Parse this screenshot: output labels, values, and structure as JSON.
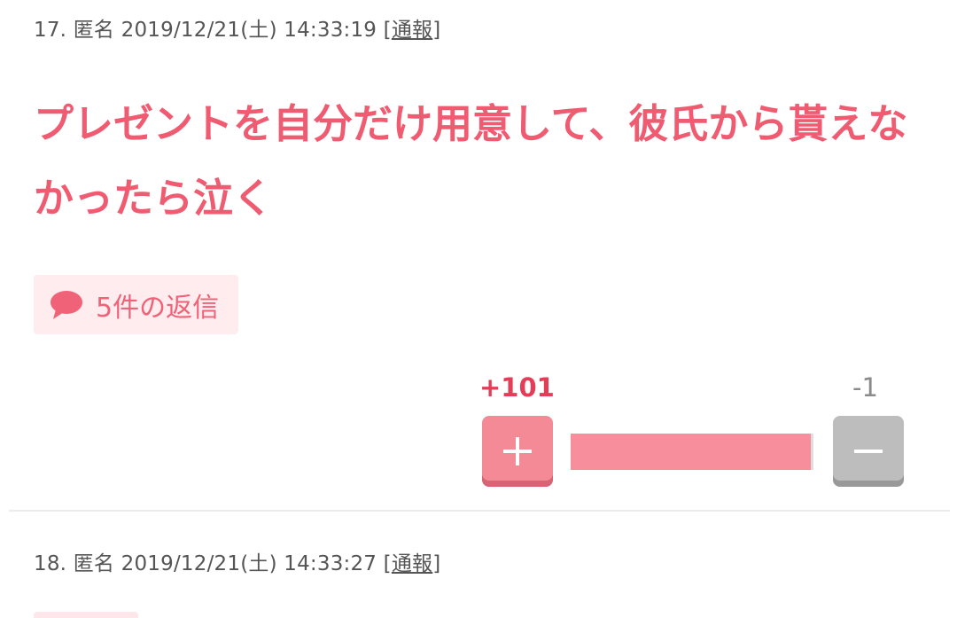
{
  "comments": [
    {
      "number": "17.",
      "author": "匿名",
      "datetime": "2019/12/21(土) 14:33:19",
      "report_label": "通報",
      "text": "プレゼントを自分だけ用意して、彼氏から貰えなかったら泣く",
      "replies_label": "5件の返信",
      "plus_count": "+101",
      "minus_count": "-1",
      "vote_ratio": 0.99
    },
    {
      "number": "18.",
      "author": "匿名",
      "datetime": "2019/12/21(土) 14:33:27",
      "report_label": "通報"
    }
  ],
  "icons": {
    "reply": "speech-bubble-icon",
    "plus": "plus-icon",
    "minus": "minus-icon"
  },
  "colors": {
    "accent": "#ef5c72",
    "plus_button": "#f58a97",
    "minus_button": "#bdbdbd",
    "plus_count": "#e53d57"
  }
}
